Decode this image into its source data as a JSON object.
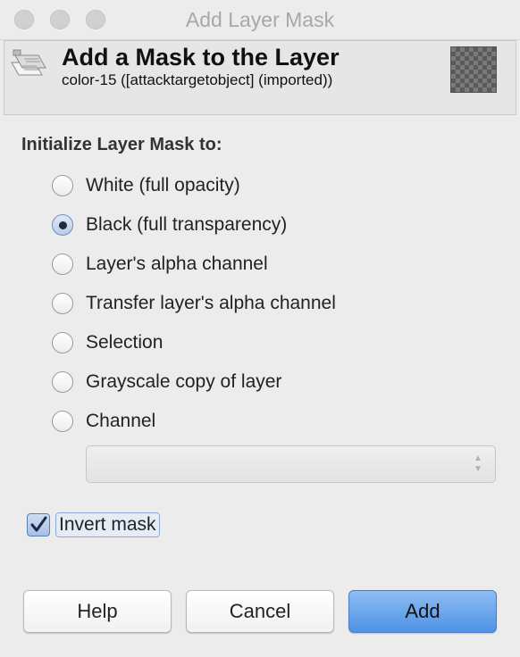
{
  "window": {
    "title": "Add Layer Mask"
  },
  "header": {
    "title": "Add a Mask to the Layer",
    "subtitle": "color-15 ([attacktargetobject] (imported))"
  },
  "section": {
    "label": "Initialize Layer Mask to:"
  },
  "options": [
    {
      "label": "White (full opacity)",
      "checked": false
    },
    {
      "label": "Black (full transparency)",
      "checked": true
    },
    {
      "label": "Layer's alpha channel",
      "checked": false
    },
    {
      "label": "Transfer layer's alpha channel",
      "checked": false
    },
    {
      "label": "Selection",
      "checked": false
    },
    {
      "label": "Grayscale copy of layer",
      "checked": false
    },
    {
      "label": "Channel",
      "checked": false
    }
  ],
  "channel_select": {
    "value": ""
  },
  "invert": {
    "label": "Invert mask",
    "checked": true
  },
  "buttons": {
    "help": "Help",
    "cancel": "Cancel",
    "add": "Add"
  },
  "colors": {
    "accent": "#4f92e5",
    "window_bg": "#ececec"
  }
}
